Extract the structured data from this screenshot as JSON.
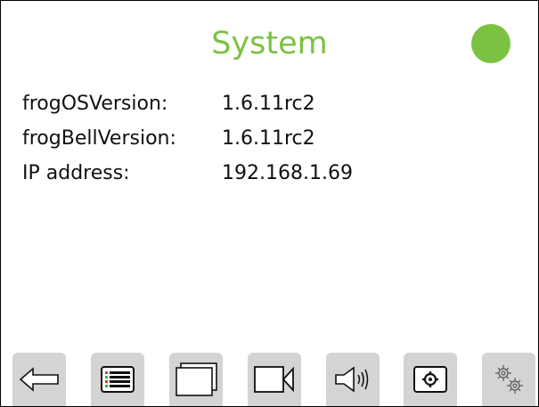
{
  "header": {
    "title": "System",
    "status_color": "#7cc242"
  },
  "info": [
    {
      "label": "frogOSVersion:",
      "value": "1.6.11rc2"
    },
    {
      "label": "frogBellVersion:",
      "value": "1.6.11rc2"
    },
    {
      "label": "IP address:",
      "value": "192.168.1.69"
    }
  ],
  "toolbar": {
    "buttons": [
      {
        "icon": "back-arrow-icon"
      },
      {
        "icon": "list-icon"
      },
      {
        "icon": "windows-icon"
      },
      {
        "icon": "video-camera-icon"
      },
      {
        "icon": "speaker-icon"
      },
      {
        "icon": "settings-icon"
      },
      {
        "icon": "gears-icon"
      }
    ]
  }
}
